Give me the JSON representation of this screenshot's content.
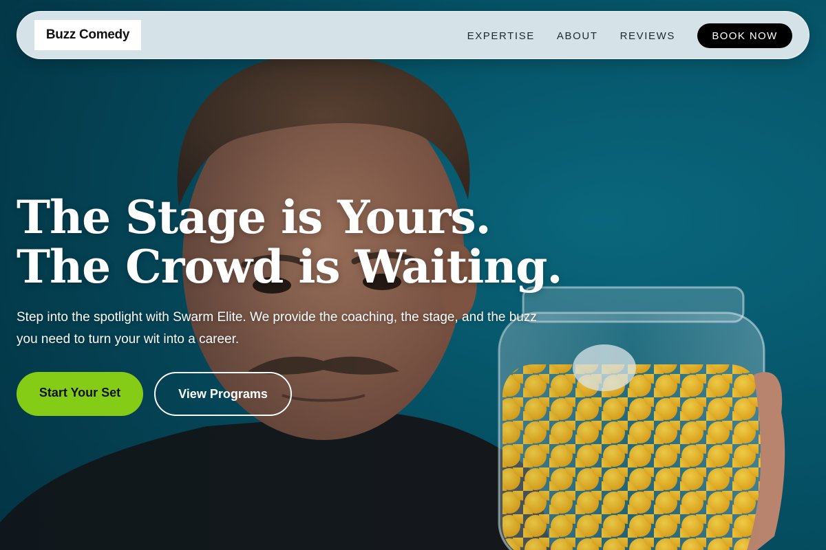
{
  "brand": {
    "logo_text": "Buzz Comedy"
  },
  "nav": {
    "links": [
      "EXPERTISE",
      "ABOUT",
      "REVIEWS"
    ],
    "cta_label": "BOOK NOW"
  },
  "hero": {
    "headline_line1": "The Stage is Yours.",
    "headline_line2": "The Crowd is Waiting.",
    "subtitle": "Step into the spotlight with Swarm Elite. We provide the coaching, the stage, and the buzz you need to turn your wit into a career.",
    "primary_button": "Start Your Set",
    "secondary_button": "View Programs",
    "background_image": "man-holding-jar-of-cheese-puffs"
  },
  "colors": {
    "hero_background": "#065a6f",
    "navbar": "#d5e2e7",
    "primary_accent": "#84cc16",
    "book_button": "#000000",
    "text_light": "#ffffff"
  }
}
